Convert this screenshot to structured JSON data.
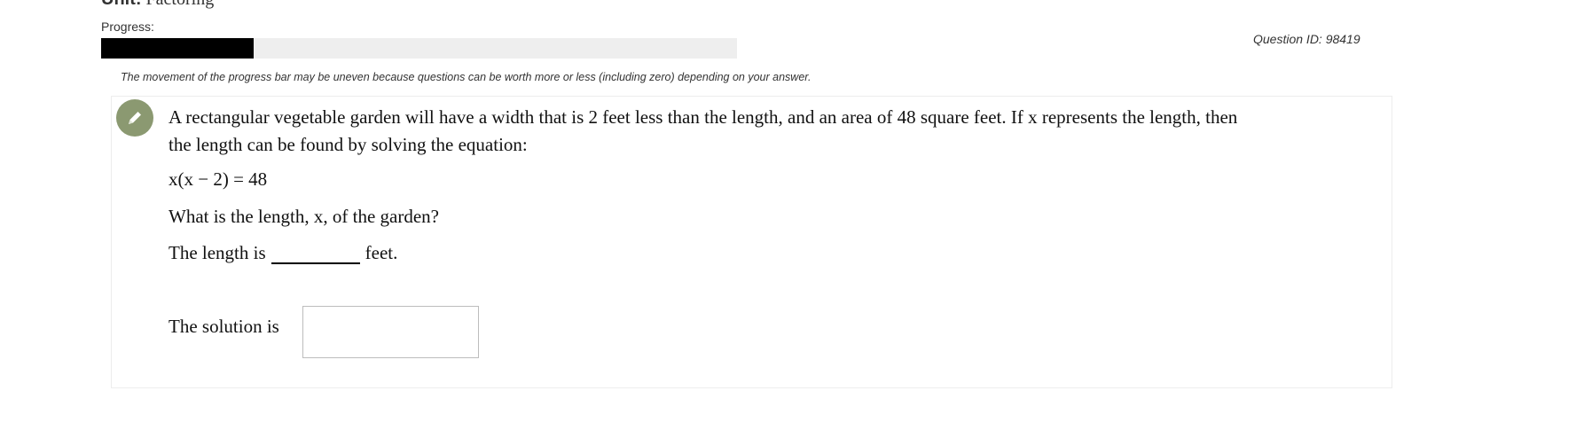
{
  "header": {
    "unit_prefix": "Unit:",
    "unit_name": "Factoring",
    "progress_label": "Progress:",
    "progress_fraction": 0.24,
    "question_id": "Question ID: 98419",
    "progress_note": "The movement of the progress bar may be uneven because questions can be worth more or less (including zero) depending on your answer."
  },
  "question": {
    "icon": "pencil-icon",
    "badge_color": "#8b9971",
    "line1": "A rectangular vegetable garden will have a width that is 2 feet less than the length, and an area of 48 square feet. If x represents the length, then",
    "line2": "the length can be found by solving the equation:",
    "equation": "x(x − 2) = 48",
    "prompt": "What is the length, x, of the garden?",
    "answer_prefix": "The length is",
    "answer_suffix": "feet.",
    "solution_label": "The solution is",
    "solution_value": ""
  }
}
